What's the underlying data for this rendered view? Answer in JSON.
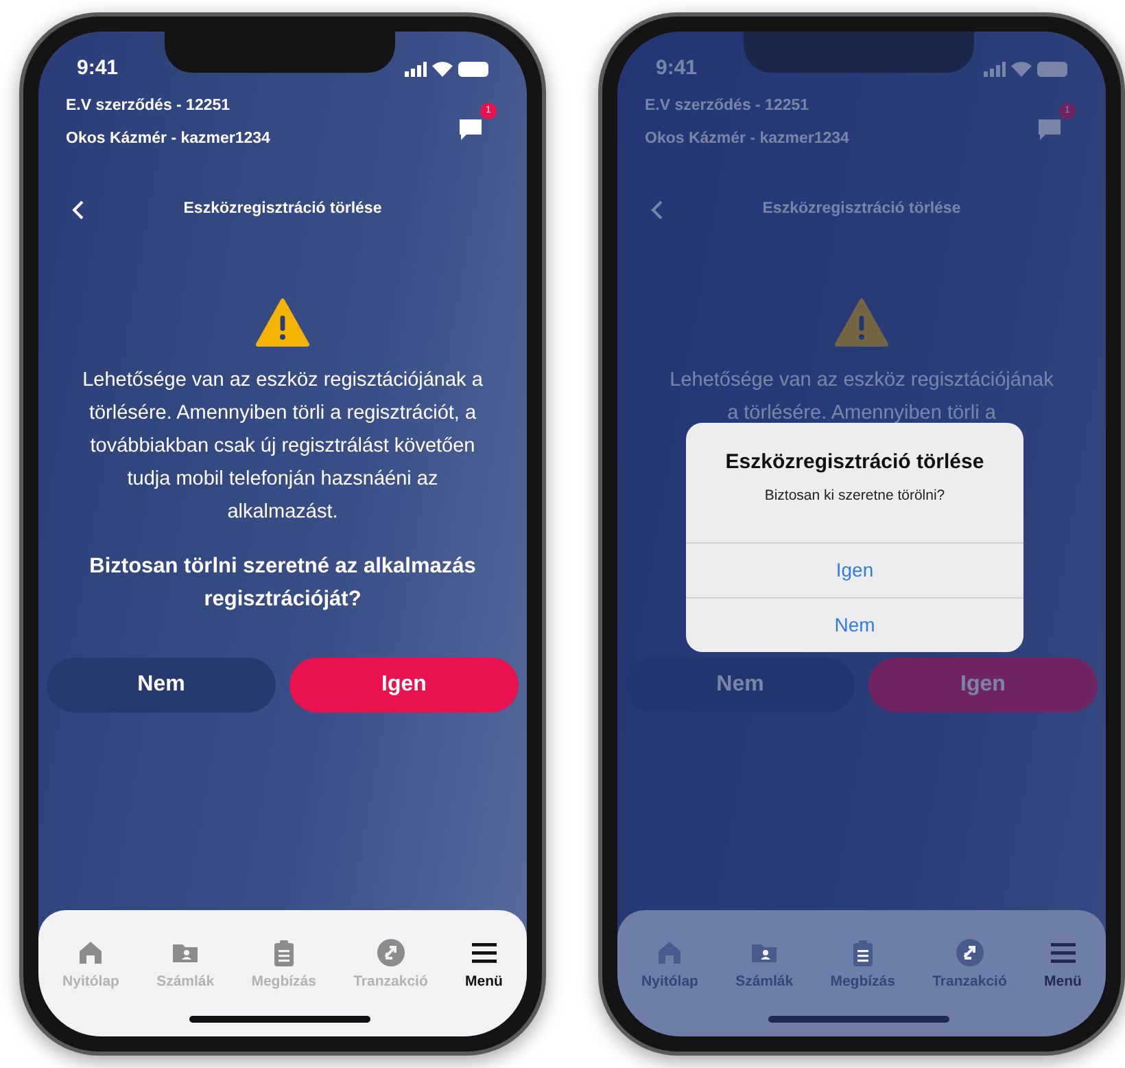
{
  "phones": [
    {
      "dimmed": false,
      "status_bar": {
        "time": "9:41"
      },
      "header": {
        "contract": "E.V szerződés - 12251",
        "user": "Okos Kázmér - kazmer1234",
        "badge": "1"
      },
      "nav_title": "Eszközregisztráció törlése",
      "description": [
        "Lehetősége van az eszköz regisztációjának a törlésére. Amennyiben törli a regisztrációt, a továbbiakban csak új regisztrálást követően tudja mobil telefonján hazsnáéni az alkalmazást."
      ],
      "question": "Biztosan törlni szeretné az alkalmazás regisztrációját?",
      "buttons": [
        {
          "label": "Nem",
          "kind": "secondary"
        },
        {
          "label": "Igen",
          "kind": "primary"
        }
      ],
      "tabs": [
        {
          "label": "Nyitólap",
          "kind": "home",
          "selected": false
        },
        {
          "label": "Számlák",
          "kind": "accounts",
          "selected": false
        },
        {
          "label": "Megbízás",
          "kind": "clipboard",
          "selected": false
        },
        {
          "label": "Tranzakció",
          "kind": "transfer",
          "selected": false
        },
        {
          "label": "Menü",
          "kind": "menu",
          "selected": true
        }
      ]
    },
    {
      "dimmed": true,
      "status_bar": {
        "time": "9:41"
      },
      "header": {
        "contract": "E.V szerződés - 12251",
        "user": "Okos Kázmér - kazmer1234",
        "badge": "1"
      },
      "nav_title": "Eszközregisztráció törlése",
      "description": [
        "Lehetősége van az eszköz regisztációjának",
        "a törlésére. Amennyiben törli a"
      ],
      "buttons": [
        {
          "label": "Nem",
          "kind": "secondary"
        },
        {
          "label": "Igen",
          "kind": "primary"
        }
      ],
      "tabs": [
        {
          "label": "Nyitólap",
          "kind": "home",
          "selected": false
        },
        {
          "label": "Számlák",
          "kind": "accounts",
          "selected": false
        },
        {
          "label": "Megbízás",
          "kind": "clipboard",
          "selected": false
        },
        {
          "label": "Tranzakció",
          "kind": "transfer",
          "selected": false
        },
        {
          "label": "Menü",
          "kind": "menu",
          "selected": true
        }
      ],
      "dialog": {
        "title": "Eszközregisztráció törlése",
        "message": "Biztosan ki szeretne törölni?",
        "actions": [
          "Igen",
          "Nem"
        ]
      }
    }
  ]
}
